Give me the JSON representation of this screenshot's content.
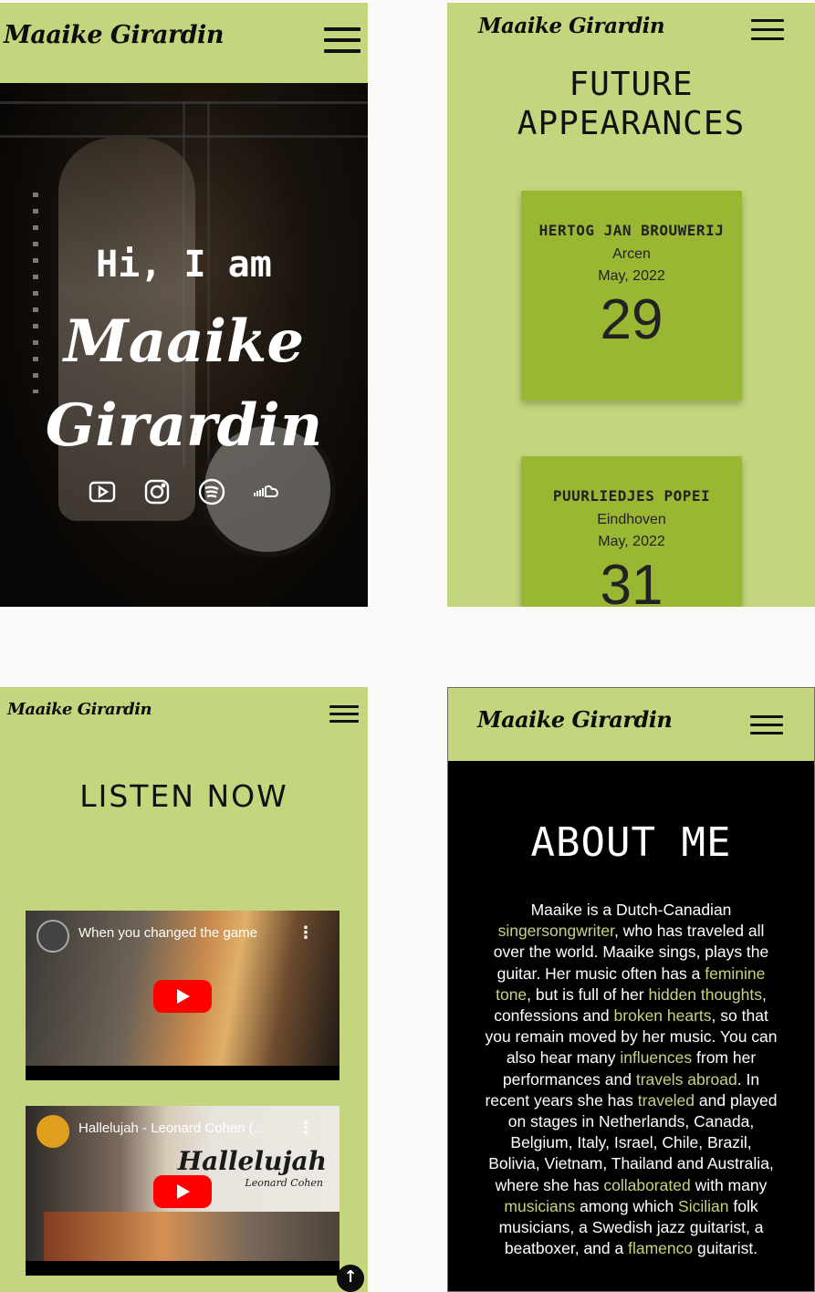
{
  "brand": "Maaike Girardin",
  "hero": {
    "greeting": "Hi, I am",
    "name_line1": "Maaike",
    "name_line2": "Girardin",
    "socials": [
      "youtube-icon",
      "instagram-icon",
      "spotify-icon",
      "soundcloud-icon"
    ]
  },
  "appearances": {
    "title_line1": "FUTURE",
    "title_line2": "APPEARANCES",
    "events": [
      {
        "venue": "HERTOG JAN BROUWERIJ",
        "city": "Arcen",
        "month": "May, 2022",
        "day": "29"
      },
      {
        "venue": "PUURLIEDJES POPEI",
        "city": "Eindhoven",
        "month": "May, 2022",
        "day": "31"
      }
    ]
  },
  "listen": {
    "title": "LISTEN NOW",
    "videos": [
      {
        "title": "When you changed the game"
      },
      {
        "title": "Hallelujah - Leonard Cohen (...",
        "overlay": "Hallelujah",
        "overlay_sub": "Leonard Cohen"
      }
    ]
  },
  "about": {
    "title": "ABOUT ME",
    "segments": [
      {
        "t": "Maaike is a Dutch-Canadian "
      },
      {
        "t": "singersongwriter",
        "h": true
      },
      {
        "t": ", who has traveled all over the world. Maaike sings, plays the guitar. Her music often has a "
      },
      {
        "t": "feminine tone",
        "h": true
      },
      {
        "t": ", but is full of her "
      },
      {
        "t": "hidden thoughts",
        "h": true
      },
      {
        "t": ", confessions and "
      },
      {
        "t": "broken hearts",
        "h": true
      },
      {
        "t": ", so that you remain moved by her music. You can also hear many "
      },
      {
        "t": "influences",
        "h": true
      },
      {
        "t": " from her performances and "
      },
      {
        "t": "travels abroad",
        "h": true
      },
      {
        "t": ". In recent years she has "
      },
      {
        "t": "traveled",
        "h": true
      },
      {
        "t": " and played on stages in Netherlands, Canada, Belgium, Italy, Israel, Chile, Brazil, Bolivia, Vietnam, Thailand and Australia, where she has "
      },
      {
        "t": "collaborated",
        "h": true
      },
      {
        "t": " with many "
      },
      {
        "t": "musicians",
        "h": true
      },
      {
        "t": " among which "
      },
      {
        "t": "Sicilian",
        "h": true
      },
      {
        "t": " folk musicians, a Swedish jazz guitarist, a beatboxer, and a "
      },
      {
        "t": "flamenco",
        "h": true
      },
      {
        "t": " guitarist."
      }
    ]
  },
  "colors": {
    "accent": "#c3d67d",
    "card": "#99b733",
    "dark": "#000000"
  }
}
